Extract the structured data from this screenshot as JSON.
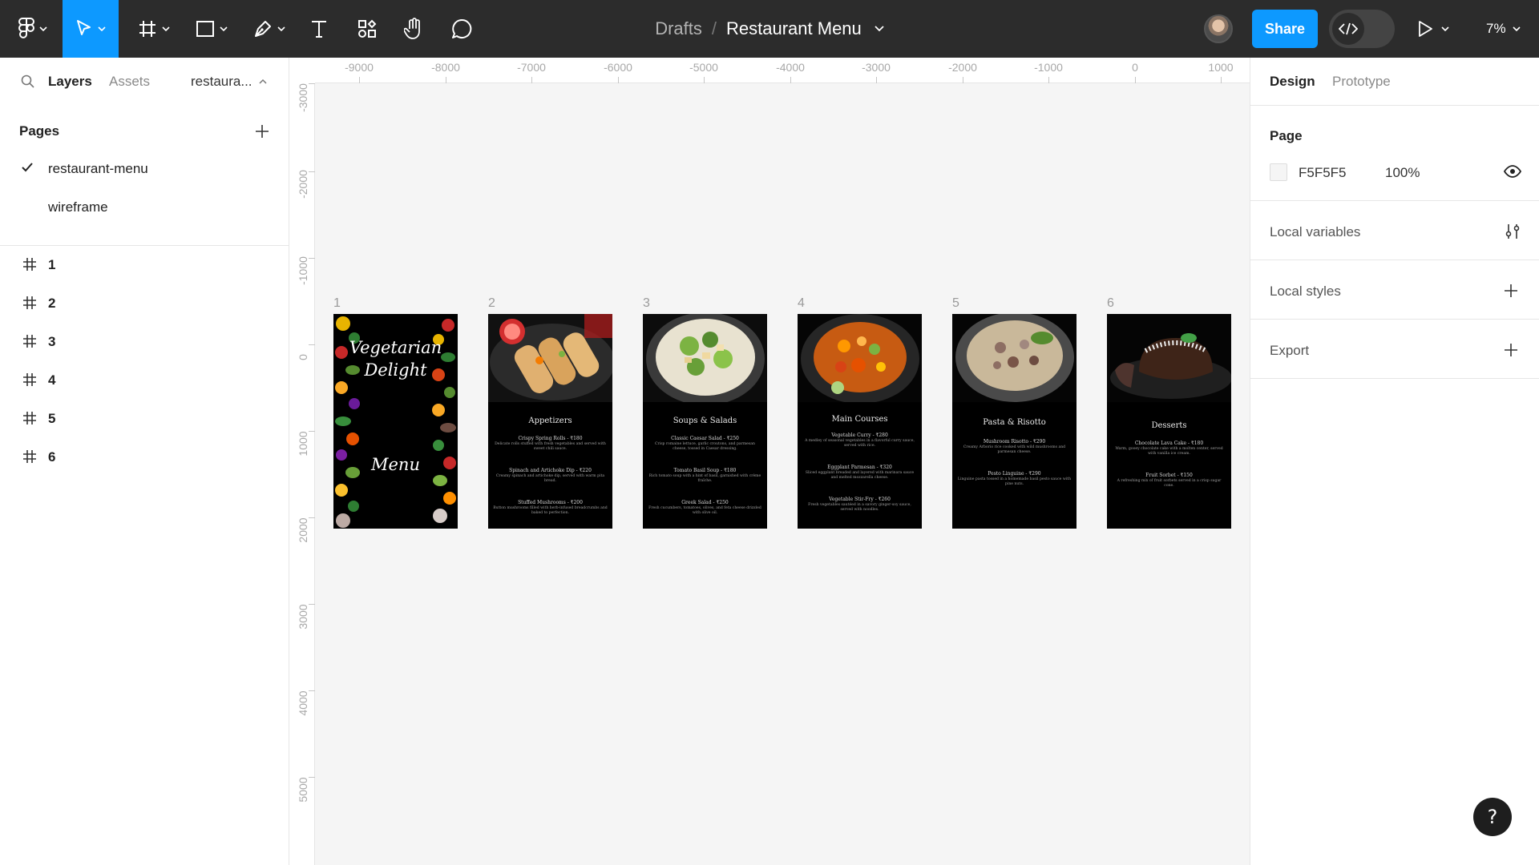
{
  "toolbar": {
    "breadcrumb": "Drafts",
    "separator": "/",
    "file_name": "Restaurant Menu",
    "share_label": "Share",
    "zoom_level": "7%"
  },
  "left_panel": {
    "tabs": {
      "layers": "Layers",
      "assets": "Assets"
    },
    "current_page": "restaura...",
    "pages_title": "Pages",
    "pages": [
      {
        "label": "restaurant-menu",
        "selected": true
      },
      {
        "label": "wireframe",
        "selected": false
      }
    ],
    "layers": [
      {
        "label": "1"
      },
      {
        "label": "2"
      },
      {
        "label": "3"
      },
      {
        "label": "4"
      },
      {
        "label": "5"
      },
      {
        "label": "6"
      }
    ]
  },
  "rulers": {
    "top": [
      "-9000",
      "-8000",
      "-7000",
      "-6000",
      "-5000",
      "-4000",
      "-3000",
      "-2000",
      "-1000",
      "0",
      "1000"
    ],
    "left": [
      "-3000",
      "-2000",
      "-1000",
      "0",
      "1000",
      "2000",
      "3000",
      "4000",
      "5000"
    ]
  },
  "frames": {
    "cover": {
      "number": "1",
      "line1": "Vegetarian",
      "line2": "Delight",
      "line3": "Menu"
    },
    "appetizers": {
      "number": "2",
      "title": "Appetizers",
      "items": [
        {
          "name": "Crispy Spring Rolls - ₹180",
          "desc": "Delicate rolls stuffed with fresh vegetables and served with sweet chili sauce."
        },
        {
          "name": "Spinach and Artichoke Dip - ₹220",
          "desc": "Creamy spinach and artichoke dip, served with warm pita bread."
        },
        {
          "name": "Stuffed Mushrooms - ₹200",
          "desc": "Button mushrooms filled with herb-infused breadcrumbs and baked to perfection."
        }
      ]
    },
    "soups": {
      "number": "3",
      "title": "Soups & Salads",
      "items": [
        {
          "name": "Classic Caesar Salad - ₹250",
          "desc": "Crisp romaine lettuce, garlic croutons, and parmesan cheese, tossed in Caesar dressing."
        },
        {
          "name": "Tomato Basil Soup - ₹180",
          "desc": "Rich tomato soup with a hint of basil, garnished with crème fraîche."
        },
        {
          "name": "Greek Salad - ₹250",
          "desc": "Fresh cucumbers, tomatoes, olives, and feta cheese drizzled with olive oil."
        }
      ]
    },
    "mains": {
      "number": "4",
      "title": "Main Courses",
      "items": [
        {
          "name": "Vegetable Curry - ₹280",
          "desc": "A medley of seasonal vegetables in a flavorful curry sauce, served with rice."
        },
        {
          "name": "Eggplant Parmesan - ₹320",
          "desc": "Sliced eggplant breaded and layered with marinara sauce and melted mozzarella cheese."
        },
        {
          "name": "Vegetable Stir-Fry - ₹260",
          "desc": "Fresh vegetables sautéed in a savory ginger-soy sauce, served with noodles."
        }
      ]
    },
    "pasta": {
      "number": "5",
      "title": "Pasta & Risotto",
      "items": [
        {
          "name": "Mushroom Risotto - ₹290",
          "desc": "Creamy Arborio rice cooked with wild mushrooms and parmesan cheese."
        },
        {
          "name": "Pesto Linguine - ₹290",
          "desc": "Linguine pasta tossed in a homemade basil pesto sauce with pine nuts."
        }
      ]
    },
    "desserts": {
      "number": "6",
      "title": "Desserts",
      "items": [
        {
          "name": "Chocolate Lava Cake - ₹180",
          "desc": "Warm, gooey chocolate cake with a molten center, served with vanilla ice cream."
        },
        {
          "name": "Fruit Sorbet - ₹150",
          "desc": "A refreshing mix of fruit sorbets served in a crisp sugar cone."
        }
      ]
    }
  },
  "right_panel": {
    "tabs": {
      "design": "Design",
      "prototype": "Prototype"
    },
    "page_title": "Page",
    "page_fill_hex": "F5F5F5",
    "page_fill_opacity": "100%",
    "sections": {
      "local_variables": "Local variables",
      "local_styles": "Local styles",
      "export": "Export"
    }
  },
  "help_label": "?",
  "colors": {
    "accent": "#0d99ff",
    "toolbar_bg": "#2c2c2c",
    "canvas_bg": "#f5f5f5",
    "frame_bg": "#000000"
  }
}
